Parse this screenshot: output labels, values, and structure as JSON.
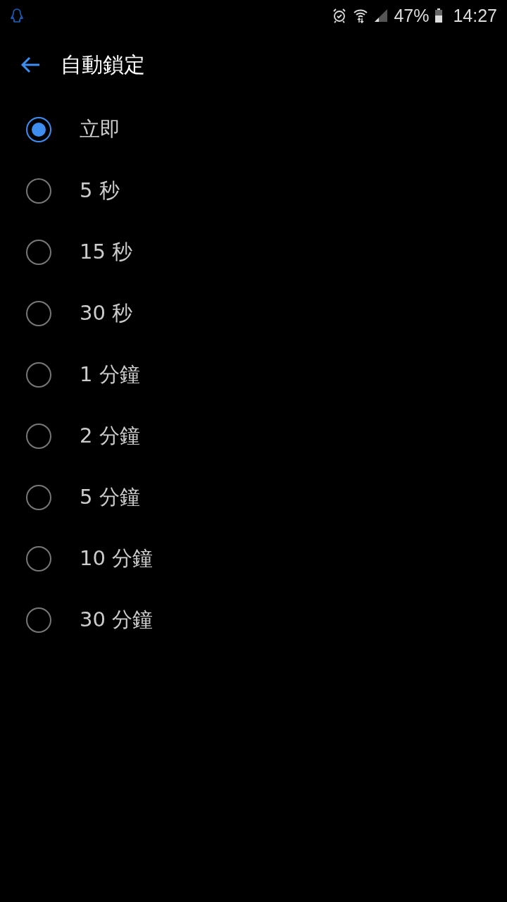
{
  "status_bar": {
    "battery": "47%",
    "time": "14:27"
  },
  "header": {
    "title": "自動鎖定"
  },
  "options": [
    {
      "label": "立即",
      "selected": true
    },
    {
      "label": "5 秒",
      "selected": false
    },
    {
      "label": "15 秒",
      "selected": false
    },
    {
      "label": "30 秒",
      "selected": false
    },
    {
      "label": "1 分鐘",
      "selected": false
    },
    {
      "label": "2 分鐘",
      "selected": false
    },
    {
      "label": "5 分鐘",
      "selected": false
    },
    {
      "label": "10 分鐘",
      "selected": false
    },
    {
      "label": "30 分鐘",
      "selected": false
    }
  ]
}
